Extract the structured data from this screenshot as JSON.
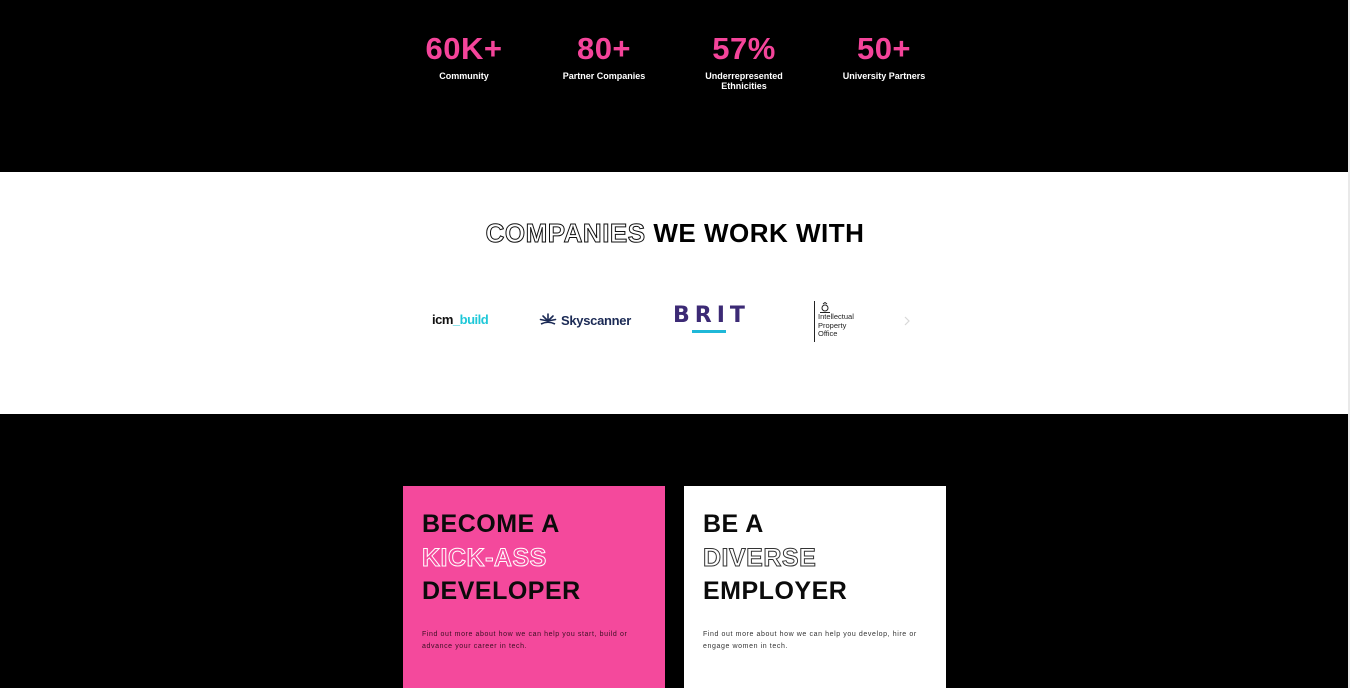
{
  "stats": [
    {
      "value": "60K+",
      "label": "Community"
    },
    {
      "value": "80+",
      "label": "Partner Companies"
    },
    {
      "value": "57%",
      "label": "Underrepresented Ethnicities"
    },
    {
      "value": "50+",
      "label": "University Partners"
    }
  ],
  "companies": {
    "title_outline": "COMPANIES",
    "title_solid": " WE WORK WITH",
    "logos": {
      "icm_part1": "icm",
      "icm_part2": "_build",
      "skyscanner": "Skyscanner",
      "brit": "BRIT",
      "ipo_line1": "Intellectual",
      "ipo_line2": "Property",
      "ipo_line3": "Office"
    },
    "next_icon": "chevron-right-icon"
  },
  "cta": {
    "developer": {
      "line1": "BECOME A",
      "line2": "KICK-ASS",
      "line3": "DEVELOPER",
      "description": "Find out more about how we can help you start, build or advance your career in tech."
    },
    "employer": {
      "line1": "BE A",
      "line2": "DIVERSE",
      "line3": "EMPLOYER",
      "description": "Find out more about how we can help you develop, hire or engage women in tech."
    }
  },
  "colors": {
    "accent_pink": "#f4499c",
    "background_dark": "#000000",
    "background_light": "#ffffff",
    "icm_teal": "#1fc8d8",
    "brit_purple": "#3c2a75"
  }
}
